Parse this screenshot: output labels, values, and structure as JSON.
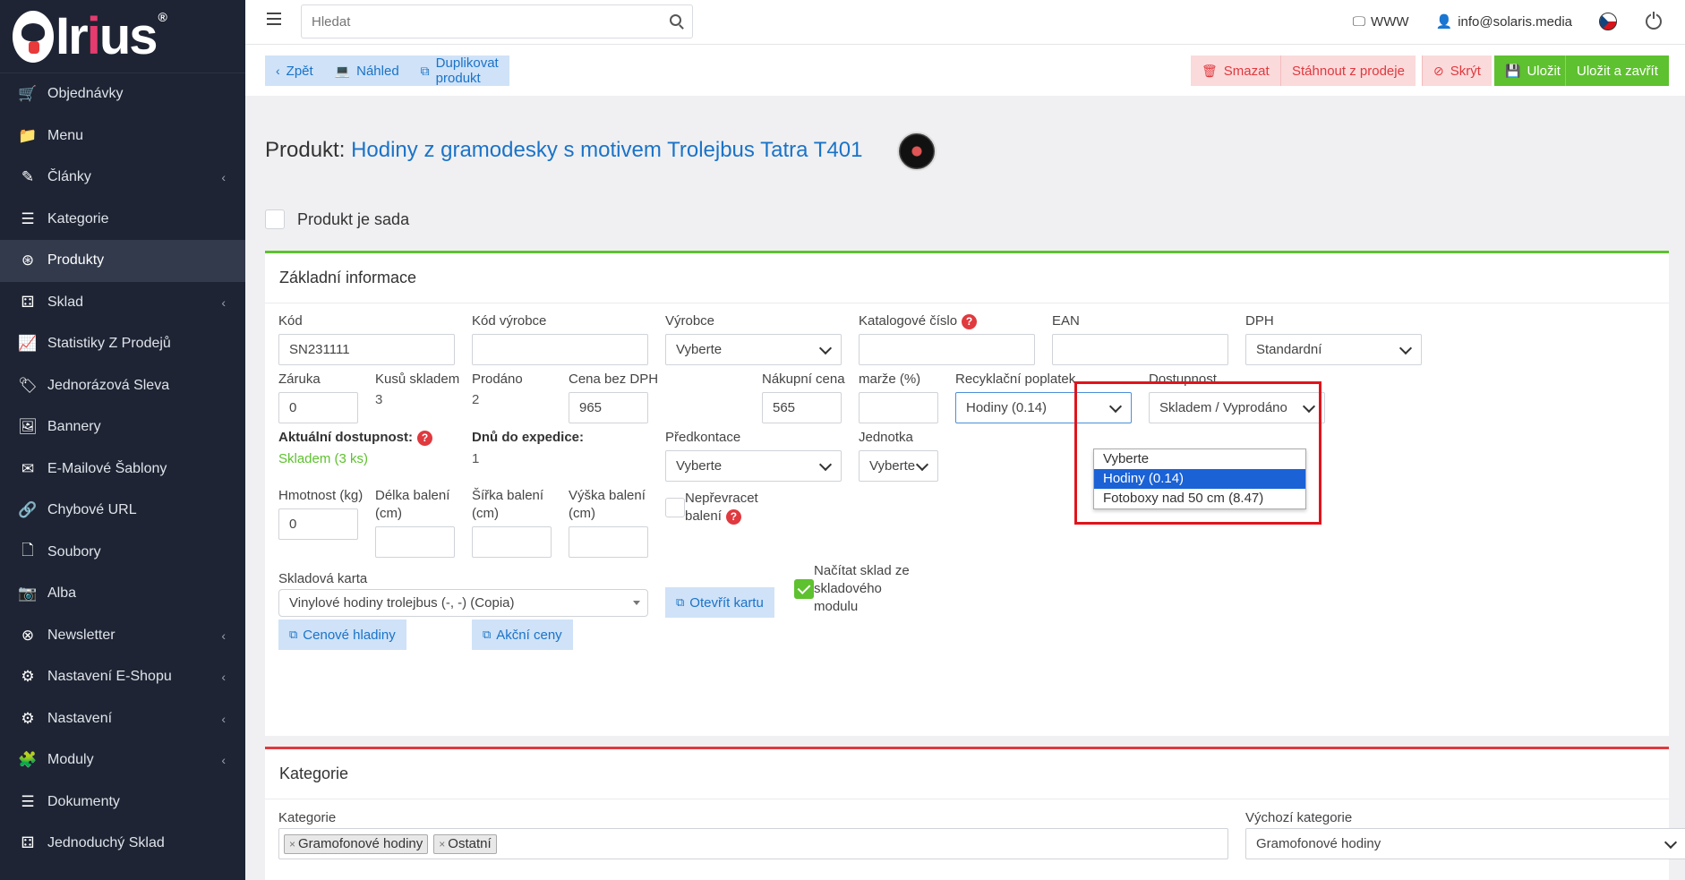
{
  "logo": {
    "text_main": "Ir",
    "text_accent": "i",
    "text_end": "us",
    "reg": "®"
  },
  "sidebar": {
    "items": [
      {
        "label": "Objednávky",
        "icon": "cart-icon",
        "chev": false
      },
      {
        "label": "Menu",
        "icon": "folder-icon",
        "chev": false
      },
      {
        "label": "Články",
        "icon": "pencil-icon",
        "chev": true
      },
      {
        "label": "Kategorie",
        "icon": "list-icon",
        "chev": false
      },
      {
        "label": "Produkty",
        "icon": "globe-icon",
        "chev": false,
        "active": true
      },
      {
        "label": "Sklad",
        "icon": "boxes-icon",
        "chev": true
      },
      {
        "label": "Statistiky Z Prodejů",
        "icon": "chart-icon",
        "chev": false
      },
      {
        "label": "Jednorázová Sleva",
        "icon": "tag-icon",
        "chev": false
      },
      {
        "label": "Bannery",
        "icon": "image-icon",
        "chev": false
      },
      {
        "label": "E-Mailové Šablony",
        "icon": "envelope-icon",
        "chev": false
      },
      {
        "label": "Chybové URL",
        "icon": "link-icon",
        "chev": false
      },
      {
        "label": "Soubory",
        "icon": "file-icon",
        "chev": false
      },
      {
        "label": "Alba",
        "icon": "camera-icon",
        "chev": false
      },
      {
        "label": "Newsletter",
        "icon": "newsletter-icon",
        "chev": true
      },
      {
        "label": "Nastavení E-Shopu",
        "icon": "cogs-icon",
        "chev": true
      },
      {
        "label": "Nastavení",
        "icon": "cogs-icon",
        "chev": true
      },
      {
        "label": "Moduly",
        "icon": "puzzle-icon",
        "chev": true
      },
      {
        "label": "Dokumenty",
        "icon": "list-icon",
        "chev": false
      },
      {
        "label": "Jednoduchý Sklad",
        "icon": "boxes-icon",
        "chev": false
      }
    ]
  },
  "topbar": {
    "search_placeholder": "Hledat",
    "www_label": "WWW",
    "user_email": "info@solaris.media"
  },
  "toolbar": {
    "back": "Zpět",
    "preview": "Náhled",
    "duplicate": "Duplikovat produkt",
    "delete": "Smazat",
    "withdraw": "Stáhnout z prodeje",
    "hide": "Skrýt",
    "save": "Uložit",
    "save_close": "Uložit a zavřít"
  },
  "product": {
    "title_label": "Produkt:",
    "title_name": "Hodiny z gramodesky s motivem Trolejbus Tatra T401",
    "is_set_label": "Produkt je sada"
  },
  "basic": {
    "header": "Základní informace",
    "code_label": "Kód",
    "code_value": "SN231111",
    "mfr_code_label": "Kód výrobce",
    "mfr_code_value": "",
    "manufacturer_label": "Výrobce",
    "manufacturer_value": "Vyberte",
    "catalog_label": "Katalogové číslo",
    "catalog_value": "",
    "ean_label": "EAN",
    "ean_value": "",
    "vat_label": "DPH",
    "vat_value": "Standardní",
    "warranty_label": "Záruka",
    "warranty_value": "0",
    "in_stock_label": "Kusů skladem",
    "in_stock_value": "3",
    "sold_label": "Prodáno",
    "sold_value": "2",
    "price_label": "Cena bez DPH",
    "price_value": "965",
    "purchase_label": "Nákupní cena",
    "purchase_value": "565",
    "margin_label": "marže (%)",
    "margin_value": "",
    "recycle_label": "Recyklační poplatek",
    "recycle_value": "Hodiny (0.14)",
    "recycle_options": [
      "Vyberte",
      "Hodiny (0.14)",
      "Fotoboxy nad 50 cm (8.47)"
    ],
    "availability_label": "Dostupnost",
    "availability_value": "Skladem / Vyprodáno",
    "current_avail_label": "Aktuální dostupnost:",
    "current_avail_value": "Skladem (3 ks)",
    "days_label": "Dnů do expedice:",
    "days_value": "1",
    "precontact_label": "Předkontace",
    "precontact_value": "Vyberte",
    "unit_label": "Jednotka",
    "unit_value": "Vyberte",
    "weight_label": "Hmotnost (kg)",
    "weight_value": "0",
    "length_label_1": "Délka balení",
    "length_label_2": "(cm)",
    "width_label_1": "Šířka balení",
    "width_label_2": "(cm)",
    "height_label_1": "Výška balení",
    "height_label_2": "(cm)",
    "no_flip_label_1": "Nepřevracet",
    "no_flip_label_2": "balení",
    "stock_card_label": "Skladová karta",
    "stock_card_value": "Vinylové hodiny trolejbus (-, -) (Copia)",
    "open_card": "Otevřít kartu",
    "load_stock_1": "Načítat sklad ze",
    "load_stock_2": "skladového",
    "load_stock_3": "modulu",
    "price_levels": "Cenové hladiny",
    "promo_prices": "Akční ceny",
    "help_mark": "?"
  },
  "category": {
    "header": "Kategorie",
    "cat_label": "Kategorie",
    "tags": [
      "Gramofonové hodiny",
      "Ostatní"
    ],
    "default_label": "Výchozí kategorie",
    "default_value": "Gramofonové hodiny"
  },
  "colors": {
    "accent": "#1a73c8",
    "success": "#5ec12f",
    "danger": "#e0393e",
    "sidebar": "#1e2433"
  }
}
